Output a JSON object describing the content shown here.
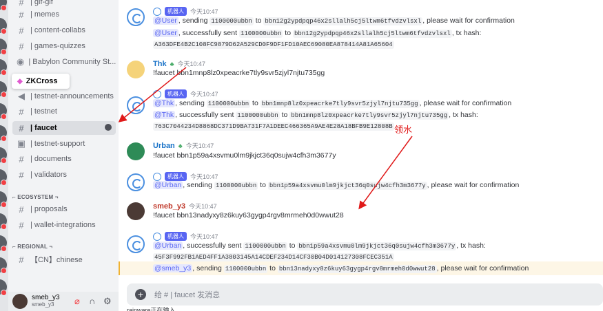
{
  "sidebar": {
    "items": [
      {
        "label": "| gif-gif"
      },
      {
        "label": "| memes"
      },
      {
        "label": "| content-collabs"
      },
      {
        "label": "| games-quizzes"
      },
      {
        "label": "| Babylon Community St..."
      },
      {
        "label": "| testnet-announcements"
      },
      {
        "label": "| testnet"
      },
      {
        "label": "| faucet"
      },
      {
        "label": "| testnet-support"
      },
      {
        "label": "| documents"
      },
      {
        "label": "| validators"
      },
      {
        "label": "| proposals"
      },
      {
        "label": "| wallet-integrations"
      },
      {
        "label": "【CN】chinese"
      }
    ],
    "tooltip": "ZKCross",
    "category_ecosystem": "⌐ ECOSYSTEM ¬",
    "category_regional": "⌐ REGIONAL ¬"
  },
  "user_panel": {
    "name": "smeb_y3",
    "tag": "smeb_y3"
  },
  "chat": {
    "bot_tag": "机器人",
    "messages": [
      {
        "time": "今天10:47",
        "l1_user": "@User",
        "l1_a": ", sending ",
        "l1_code1": "1100000ubbn",
        "l1_b": " to ",
        "l1_code2": "bbn12g2ypdpqp46x2sllalh5cj5ltwm6tfvdzvlsxl",
        "l1_c": ", please wait for confirmation",
        "l2_user": "@User",
        "l2_a": ", successfully sent ",
        "l2_code1": "1100000ubbn",
        "l2_b": " to ",
        "l2_code2": "bbn12g2ypdpqp46x2sllalh5cj5ltwm6tfvdzvlsxl",
        "l2_c": ", tx hash:",
        "l3_hash": "A363DFE4B2C108FC9879D62A529CD0F9DF1FD10AEC69080EA878414A81A65604"
      },
      {
        "name": "Thk",
        "time": "今天10:47",
        "text": "!faucet bbn1mnp8lz0xpeacrke7tly9svr5zjyl7njtu735gg"
      },
      {
        "time": "今天10:47",
        "l1_user": "@Thk",
        "l1_a": ", sending ",
        "l1_code1": "1100000ubbn",
        "l1_b": " to ",
        "l1_code2": "bbn1mnp8lz0xpeacrke7tly9svr5zjyl7njtu735gg",
        "l1_c": ", please wait for confirmation",
        "l2_user": "@Thk",
        "l2_a": ", successfully sent ",
        "l2_code1": "1100000ubbn",
        "l2_b": " to ",
        "l2_code2": "bbn1mnp8lz0xpeacrke7tly9svr5zjyl7njtu735gg",
        "l2_c": ", tx hash:",
        "l3_hash": "763C7044234D8868DC371D9BA731F7A1DEEC466365A9AE4E28A18BFB9E12808B"
      },
      {
        "name": "Urban",
        "time": "今天10:47",
        "text": "!faucet bbn1p59a4xsvmu0lm9jkjct36q0sujw4cfh3m3677y"
      },
      {
        "time": "今天10:47",
        "l1_user": "@Urban",
        "l1_a": ", sending ",
        "l1_code1": "1100000ubbn",
        "l1_b": " to ",
        "l1_code2": "bbn1p59a4xsvmu0lm9jkjct36q0sujw4cfh3m3677y",
        "l1_c": ", please wait for confirmation"
      },
      {
        "name": "smeb_y3",
        "time": "今天10:47",
        "text": "!faucet bbn13nadyxy8z6kuy63gygp4rgv8mrmeh0d0wwut28"
      },
      {
        "time": "今天10:47",
        "l1_user": "@Urban",
        "l1_a": ", successfully sent ",
        "l1_code1": "1100000ubbn",
        "l1_b": " to ",
        "l1_code2": "bbn1p59a4xsvmu0lm9jkjct36q0sujw4cfh3m3677y",
        "l1_c": ", tx hash:",
        "l2_hash": "45F3F992FB1AED4FF1A3803145A14CDEF234D14CF30B04D014127308FCEC351A",
        "l3_user": "@smeb_y3",
        "l3_a": ", sending ",
        "l3_code1": "1100000ubbn",
        "l3_b": " to ",
        "l3_code2": "bbn13nadyxy8z6kuy63gygp4rgv8mrmeh0d0wwut28",
        "l3_c": ", please wait for confirmation"
      }
    ],
    "input_placeholder": "给 # | faucet 发消息",
    "typing": "rainware正在输入..."
  },
  "annotation": {
    "label": "领水",
    "color": "#e01919"
  },
  "colors": {
    "mention": "#5865f2",
    "bot_tag": "#5865f2",
    "thk": "#1a73c8",
    "urban": "#1a73c8",
    "smeb": "#c0392b"
  }
}
